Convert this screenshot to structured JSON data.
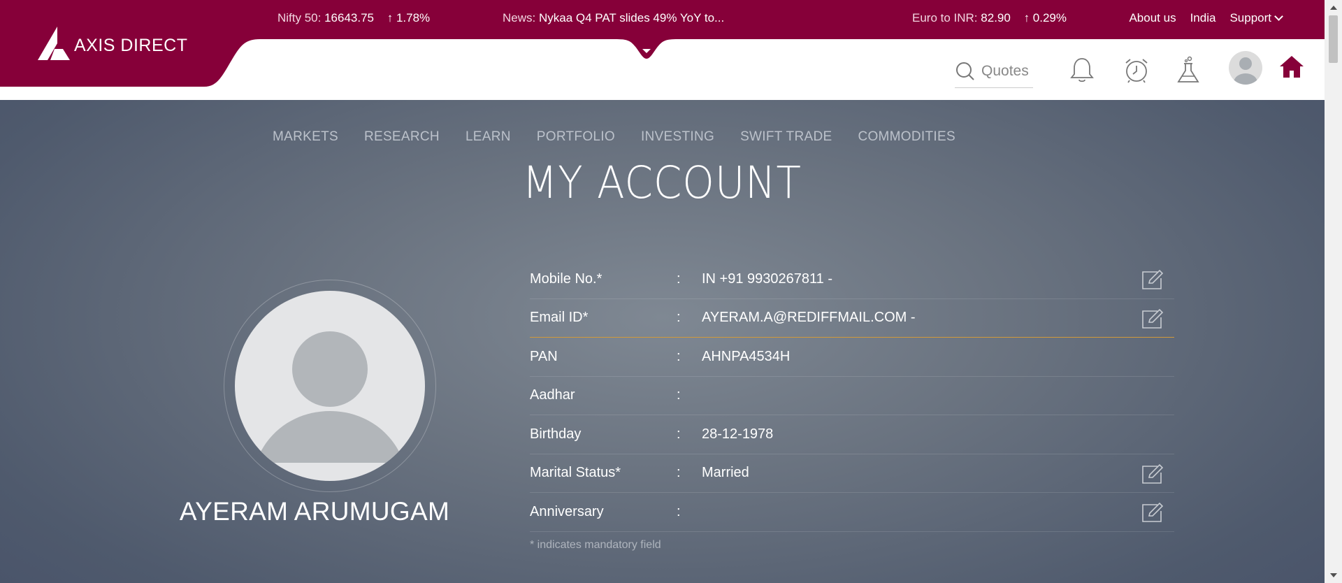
{
  "brand": {
    "name": "AXIS DIRECT",
    "color": "#860039"
  },
  "ticker": {
    "nifty_label": "Nifty 50:",
    "nifty_value": "16643.75",
    "nifty_change": "1.78%",
    "news_label": "News:",
    "news_text": "Nykaa Q4 PAT slides 49% YoY to...",
    "euro_label": "Euro to INR:",
    "euro_value": "82.90",
    "euro_change": "0.29%"
  },
  "top_links": {
    "about": "About us",
    "country": "India",
    "support": "Support"
  },
  "header": {
    "quotes_placeholder": "Quotes",
    "icons": [
      "search-icon",
      "bell-icon",
      "alarm-clock-icon",
      "flask-icon",
      "user-avatar-icon",
      "home-icon"
    ]
  },
  "nav": [
    "MARKETS",
    "RESEARCH",
    "LEARN",
    "PORTFOLIO",
    "INVESTING",
    "SWIFT TRADE",
    "COMMODITIES"
  ],
  "page_title": "MY ACCOUNT",
  "user": {
    "name": "AYERAM ARUMUGAM"
  },
  "details": [
    {
      "label": "Mobile No.*",
      "value": "IN +91 9930267811  -",
      "editable": true
    },
    {
      "label": "Email ID*",
      "value": "AYERAM.A@REDIFFMAIL.COM  -",
      "editable": true
    },
    {
      "label": "PAN",
      "value": "AHNPA4534H",
      "editable": false
    },
    {
      "label": "Aadhar",
      "value": "",
      "editable": false
    },
    {
      "label": "Birthday",
      "value": "28-12-1978",
      "editable": false
    },
    {
      "label": "Marital Status*",
      "value": "Married",
      "editable": true
    },
    {
      "label": "Anniversary",
      "value": "",
      "editable": true
    }
  ],
  "colon": ":",
  "mandatory_note": "* indicates mandatory field"
}
